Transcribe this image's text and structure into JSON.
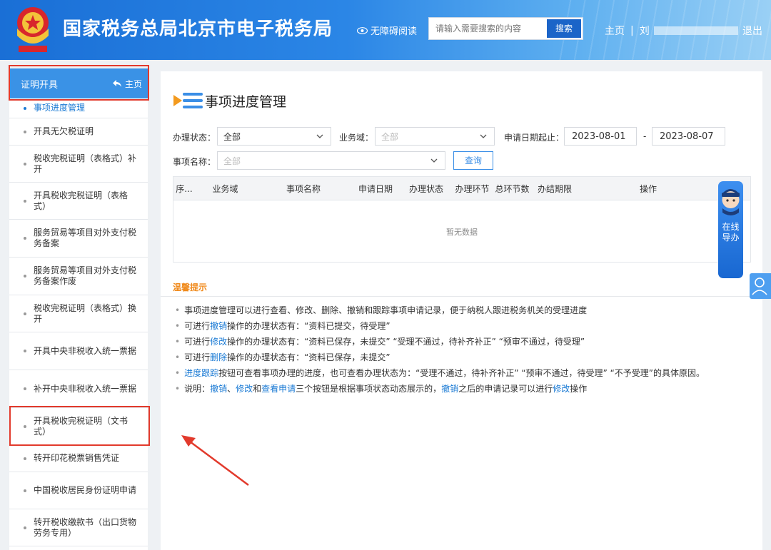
{
  "header": {
    "title": "国家税务总局北京市电子税务局",
    "accessibility": "无障碍阅读",
    "search_placeholder": "请输入需要搜索的内容",
    "search_button": "搜索",
    "home_link": "主页",
    "separator": "|",
    "user_prefix": "刘",
    "logout": "退出"
  },
  "sidebar": {
    "title": "证明开具",
    "home_label": "主页",
    "items": [
      {
        "label": "事项进度管理",
        "active": true
      },
      {
        "label": "开具无欠税证明"
      },
      {
        "label": "税收完税证明（表格式）补开"
      },
      {
        "label": "开具税收完税证明（表格式）"
      },
      {
        "label": "服务贸易等项目对外支付税务备案"
      },
      {
        "label": "服务贸易等项目对外支付税务备案作废"
      },
      {
        "label": "税收完税证明（表格式）换开"
      },
      {
        "label": "开具中央非税收入统一票据"
      },
      {
        "label": "补开中央非税收入统一票据"
      },
      {
        "label": "开具税收完税证明（文书式）"
      },
      {
        "label": "转开印花税票销售凭证"
      },
      {
        "label": "中国税收居民身份证明申请"
      },
      {
        "label": "转开税收缴款书（出口货物劳务专用）"
      }
    ]
  },
  "main": {
    "title": "事项进度管理",
    "filters": {
      "status_label": "办理状态：",
      "status_value": "全部",
      "domain_label": "业务域：",
      "domain_placeholder": "全部",
      "date_label": "申请日期起止：",
      "date_start": "2023-08-01",
      "date_sep": "-",
      "date_end": "2023-08-07",
      "name_label": "事项名称：",
      "name_placeholder": "全部",
      "query_button": "查询"
    },
    "table": {
      "columns": [
        "序...",
        "业务域",
        "事项名称",
        "申请日期",
        "办理状态",
        "办理环节",
        "总环节数",
        "办结期限",
        "操作"
      ],
      "empty_text": "暂无数据"
    },
    "tips": {
      "title": "温馨提示",
      "bullet": "•",
      "t1": "事项进度管理可以进行查看、修改、删除、撤销和跟踪事项申请记录，便于纳税人跟进税务机关的受理进度",
      "t2a": "可进行",
      "t2b": "撤销",
      "t2c": "操作的办理状态有：“资料已提交，待受理”",
      "t3a": "可进行",
      "t3b": "修改",
      "t3c": "操作的办理状态有：“资料已保存，未提交” “受理不通过，待补齐补正” “预审不通过，待受理”",
      "t4a": "可进行",
      "t4b": "删除",
      "t4c": "操作的办理状态有：“资料已保存，未提交”",
      "t5a": "进度跟踪",
      "t5b": "按钮可查看事项办理的进度，也可查看办理状态为：“受理不通过，待补齐补正” “预审不通过，待受理” “不予受理”的具体原因。",
      "t6a": "说明：",
      "t6b": "撤销",
      "t6c": "、",
      "t6d": "修改",
      "t6e": "和",
      "t6f": "查看申请",
      "t6g": "三个按钮是根据事项状态动态展示的，",
      "t6h": "撤销",
      "t6i": "之后的申请记录可以进行",
      "t6j": "修改",
      "t6k": "操作"
    }
  },
  "float": {
    "guide_text": "在线导办"
  },
  "colors": {
    "header_blue": "#1a6fd6",
    "sidebar_head": "#3a92e6",
    "link": "#1a7ad4",
    "tips_title": "#f08a1c",
    "highlight_red": "#e23a2c"
  }
}
